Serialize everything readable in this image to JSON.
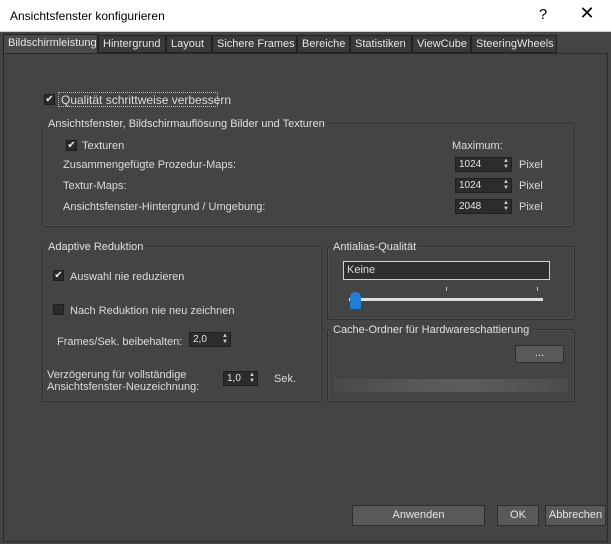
{
  "window": {
    "title": "Ansichtsfenster konfigurieren",
    "help_glyph": "?",
    "close_glyph": "✕"
  },
  "tabs": [
    {
      "label": "Bildschirmleistung",
      "active": true
    },
    {
      "label": "Hintergrund"
    },
    {
      "label": "Layout"
    },
    {
      "label": "Sichere Frames"
    },
    {
      "label": "Bereiche"
    },
    {
      "label": "Statistiken"
    },
    {
      "label": "ViewCube"
    },
    {
      "label": "SteeringWheels"
    }
  ],
  "progressive": {
    "label": "Qualität schrittweise verbessern",
    "checked": true
  },
  "resolution_group": {
    "title": "Ansichtsfenster, Bildschirmauflösung Bilder und Texturen",
    "textures_label": "Texturen",
    "textures_checked": true,
    "maximum_label": "Maximum:",
    "rows": [
      {
        "label": "Zusammengefügte Prozedur-Maps:",
        "value": "1024",
        "unit": "Pixel"
      },
      {
        "label": "Textur-Maps:",
        "value": "1024",
        "unit": "Pixel"
      },
      {
        "label": "Ansichtsfenster-Hintergrund / Umgebung:",
        "value": "2048",
        "unit": "Pixel"
      }
    ]
  },
  "adaptive_group": {
    "title": "Adaptive Reduktion",
    "selection_label": "Auswahl nie reduzieren",
    "selection_checked": true,
    "noredraw_label": "Nach Reduktion nie neu zeichnen",
    "noredraw_checked": false,
    "fps_label": "Frames/Sek. beibehalten:",
    "fps_value": "2,0",
    "delay_label_1": "Verzögerung für vollständige",
    "delay_label_2": "Ansichtsfenster-Neuzeichnung:",
    "delay_value": "1,0",
    "delay_unit": "Sek."
  },
  "antialias_group": {
    "title": "Antialias-Qualität",
    "value": "Keine",
    "slider_level": 0
  },
  "cache_group": {
    "title": "Cache-Ordner für Hardwareschattierung",
    "browse_label": "..."
  },
  "footer": {
    "apply_label": "Anwenden",
    "ok_label": "OK",
    "cancel_label": "Abbrechen"
  },
  "colors": {
    "background": "#444444",
    "slider_thumb": "#1e7fd6",
    "titlebar": "#ffffff"
  }
}
